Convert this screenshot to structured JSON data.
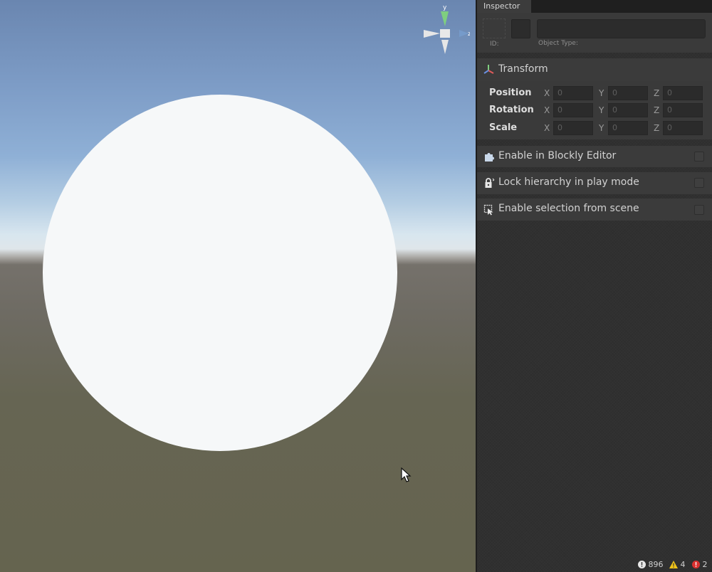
{
  "inspector": {
    "tab_label": "Inspector",
    "id_label": "ID:",
    "object_type_label": "Object Type:",
    "transform": {
      "title": "Transform",
      "rows": [
        {
          "label": "Position",
          "x": "0",
          "y": "0",
          "z": "0"
        },
        {
          "label": "Rotation",
          "x": "0",
          "y": "0",
          "z": "0"
        },
        {
          "label": "Scale",
          "x": "0",
          "y": "0",
          "z": "0"
        }
      ],
      "axis_x": "X",
      "axis_y": "Y",
      "axis_z": "Z"
    },
    "options": [
      {
        "label": "Enable in Blockly Editor",
        "icon": "puzzle-icon"
      },
      {
        "label": "Lock hierarchy in play mode",
        "icon": "lock-icon"
      },
      {
        "label": "Enable selection from scene",
        "icon": "select-cursor-icon"
      }
    ]
  },
  "gizmo": {
    "y_label": "y",
    "z_label": "z"
  },
  "status": {
    "info_count": "896",
    "warning_count": "4",
    "error_count": "2"
  },
  "colors": {
    "sphere": "#f6f8f9",
    "panel_bg": "#323232",
    "section_bg": "#3b3b3b",
    "gizmo_y": "#7fcf7f",
    "gizmo_z": "#7aa6d8"
  }
}
